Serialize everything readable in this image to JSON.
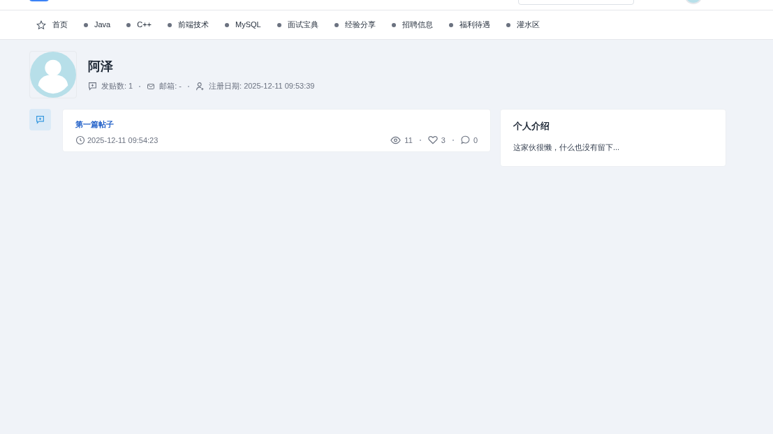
{
  "nav": [
    {
      "label": "首页",
      "kind": "home"
    },
    {
      "label": "Java",
      "kind": "category"
    },
    {
      "label": "C++",
      "kind": "category"
    },
    {
      "label": "前端技术",
      "kind": "category"
    },
    {
      "label": "MySQL",
      "kind": "category"
    },
    {
      "label": "面试宝典",
      "kind": "category"
    },
    {
      "label": "经验分享",
      "kind": "category"
    },
    {
      "label": "招聘信息",
      "kind": "category"
    },
    {
      "label": "福利待遇",
      "kind": "category"
    },
    {
      "label": "灌水区",
      "kind": "category"
    }
  ],
  "profile": {
    "name": "阿泽",
    "posts": "发贴数: 1",
    "email": "邮箱: -",
    "registered": "注册日期: 2025-12-11 09:53:39"
  },
  "posts": [
    {
      "title": "第一篇帖子",
      "time": "2025-12-11 09:54:23",
      "views": "11",
      "likes": "3",
      "comments": "0"
    }
  ],
  "intro": {
    "title": "个人介绍",
    "text": "这家伙很懒，什么也没有留下..."
  }
}
